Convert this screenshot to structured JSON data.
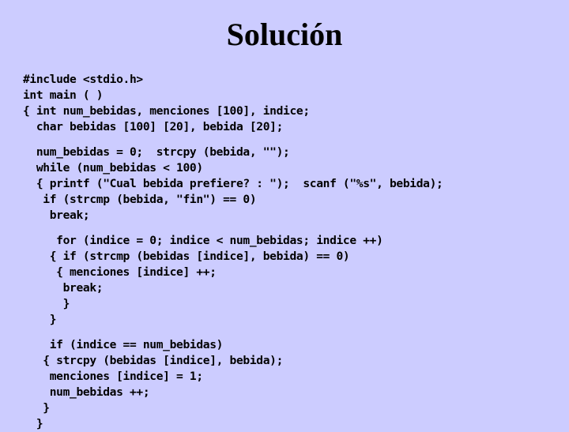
{
  "slide": {
    "title": "Solución",
    "background_color": "#ccccff",
    "text_color": "#000000"
  },
  "code": {
    "language": "c",
    "lines": [
      "#include <stdio.h>",
      "int main ( )",
      "{ int num_bebidas, menciones [100], indice;",
      "  char bebidas [100] [20], bebida [20];",
      "",
      "  num_bebidas = 0;  strcpy (bebida, \"\");",
      "  while (num_bebidas < 100)",
      "  { printf (\"Cual bebida prefiere? : \");  scanf (\"%s\", bebida);",
      "   if (strcmp (bebida, \"fin\") == 0)",
      "    break;",
      "",
      "     for (indice = 0; indice < num_bebidas; indice ++)",
      "    { if (strcmp (bebidas [indice], bebida) == 0)",
      "     { menciones [indice] ++;",
      "      break;",
      "      }",
      "    }",
      "",
      "    if (indice == num_bebidas)",
      "   { strcpy (bebidas [indice], bebida);",
      "    menciones [indice] = 1;",
      "    num_bebidas ++;",
      "   }",
      "  }"
    ]
  }
}
